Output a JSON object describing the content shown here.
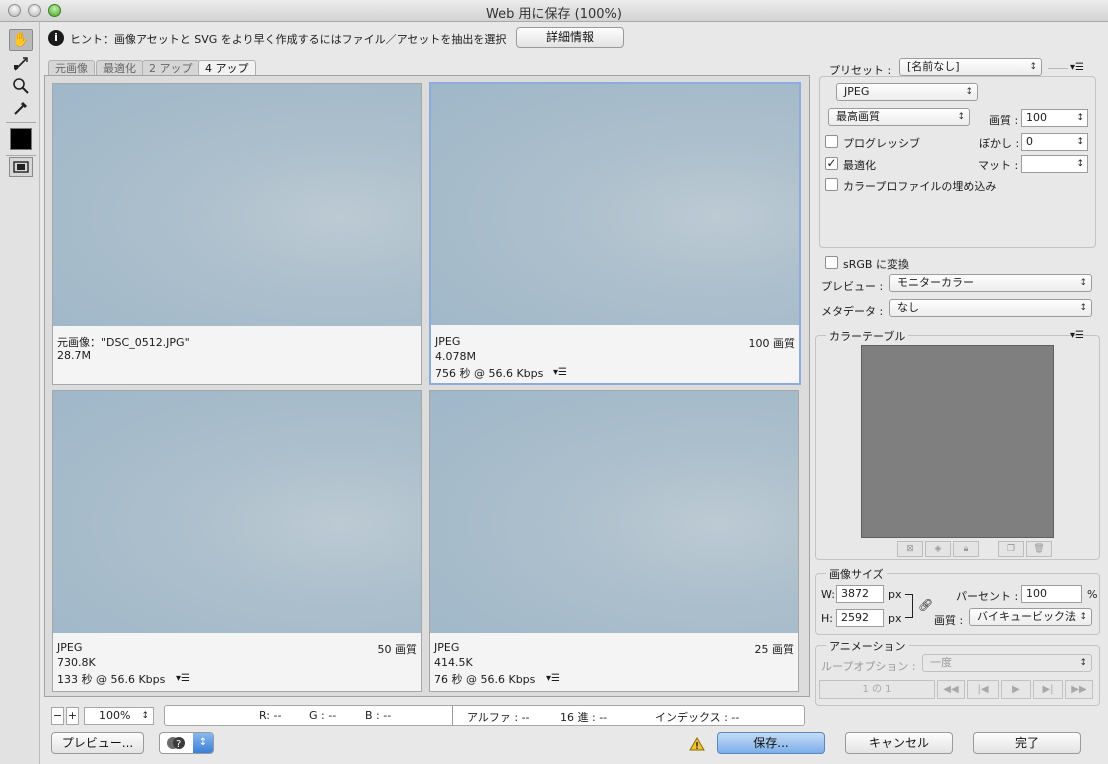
{
  "window": {
    "title": "Web 用に保存 (100%)"
  },
  "hint": {
    "text": "ヒント：画像アセットと SVG をより早く作成するにはファイル／アセットを抽出を選択",
    "button": "詳細情報"
  },
  "tabs": [
    "元画像",
    "最適化",
    "2 アップ",
    "4 アップ"
  ],
  "active_tab": "4 アップ",
  "panes": [
    {
      "format": "元画像：\"DSC_0512.JPG\"",
      "quality": "",
      "size": "28.7M",
      "time": ""
    },
    {
      "format": "JPEG",
      "quality": "100 画質",
      "size": "4.078M",
      "time": "756 秒 @ 56.6 Kbps"
    },
    {
      "format": "JPEG",
      "quality": "50 画質",
      "size": "730.8K",
      "time": "133 秒 @ 56.6 Kbps"
    },
    {
      "format": "JPEG",
      "quality": "25 画質",
      "size": "414.5K",
      "time": "76 秒 @ 56.6 Kbps"
    }
  ],
  "zoom": {
    "minus": "−",
    "plus": "+",
    "value": "100%"
  },
  "status": {
    "r": "R: --",
    "g": "G : --",
    "b": "B : --",
    "alpha": "アルファ : --",
    "hex": "16 進 : --",
    "index": "インデックス : --"
  },
  "footer": {
    "preview": "プレビュー...",
    "save": "保存...",
    "cancel": "キャンセル",
    "done": "完了"
  },
  "settings": {
    "preset_label": "プリセット :",
    "preset_value": "[名前なし]",
    "format": "JPEG",
    "quality_preset": "最高画質",
    "quality_label": "画質 :",
    "quality_value": "100",
    "progressive": "プログレッシブ",
    "blur_label": "ぼかし :",
    "blur_value": "0",
    "optimized": "最適化",
    "matte_label": "マット :",
    "matte_value": "",
    "embed_profile": "カラープロファイルの埋め込み",
    "srgb": "sRGB に変換",
    "preview_label": "プレビュー :",
    "preview_value": "モニターカラー",
    "metadata_label": "メタデータ :",
    "metadata_value": "なし"
  },
  "color_table": {
    "title": "カラーテーブル"
  },
  "image_size": {
    "title": "画像サイズ",
    "w_label": "W:",
    "w_value": "3872",
    "w_unit": "px",
    "h_label": "H:",
    "h_value": "2592",
    "h_unit": "px",
    "percent_label": "パーセント :",
    "percent_value": "100",
    "percent_unit": "%",
    "quality_label": "画質 :",
    "quality_value": "バイキュービック法"
  },
  "animation": {
    "title": "アニメーション",
    "loop_label": "ループオプション :",
    "loop_value": "一度",
    "frame": "1 の 1"
  },
  "colors": {
    "accent_blue": "#8eabdc",
    "color_table_gray": "#7f7f7f",
    "photo_sky": "#a9bfcf"
  }
}
